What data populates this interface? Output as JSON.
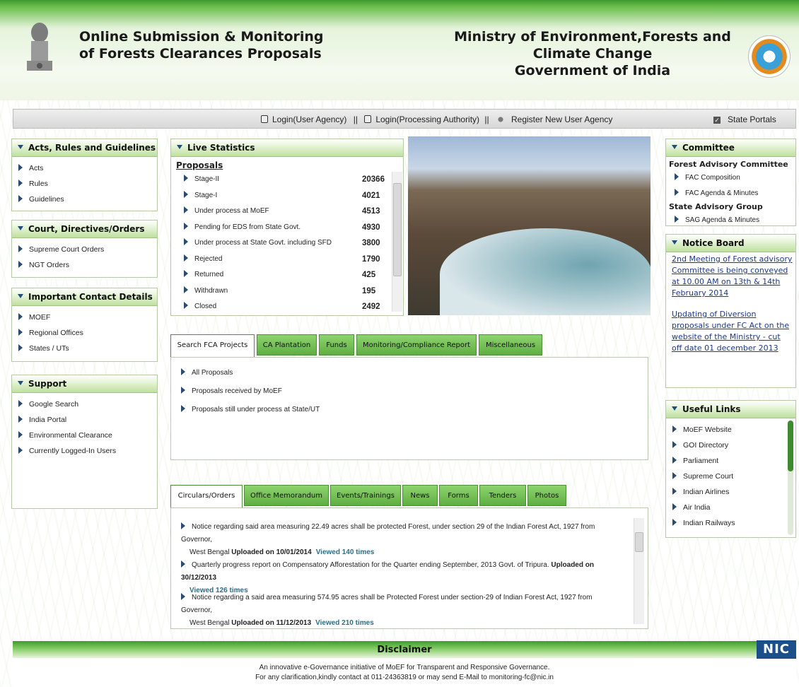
{
  "header": {
    "title_line1": "Online Submission & Monitoring",
    "title_line2": "of Forests Clearances Proposals",
    "ministry_line1": "Ministry of Environment,Forests and Climate Change",
    "ministry_line2": "Government of India"
  },
  "topbar": {
    "login_user": "Login(User Agency)",
    "sep1": "||",
    "login_processing": "Login(Processing Authority)",
    "sep2": "||",
    "register": "Register New User Agency",
    "state_portals": "State Portals"
  },
  "acts": {
    "title": "Acts, Rules and Guidelines",
    "items": [
      "Acts",
      "Rules",
      "Guidelines"
    ]
  },
  "court": {
    "title": "Court, Directives/Orders",
    "items": [
      "Supreme Court Orders",
      "NGT Orders"
    ]
  },
  "contacts": {
    "title": "Important Contact Details",
    "items": [
      "MOEF",
      "Regional Offices",
      "States / UTs"
    ]
  },
  "support": {
    "title": "Support",
    "items": [
      "Google Search",
      "India Portal",
      "Environmental Clearance",
      "Currently Logged-In Users"
    ]
  },
  "stats": {
    "title": "Live Statistics",
    "subtitle": "Proposals",
    "rows": [
      {
        "label": "Stage-II",
        "value": "20366"
      },
      {
        "label": "Stage-I",
        "value": "4021"
      },
      {
        "label": "Under process at MoEF",
        "value": "4513"
      },
      {
        "label": "Pending for EDS from State Govt.",
        "value": "4930"
      },
      {
        "label": "Under process at State Govt. including SFD",
        "value": "3800"
      },
      {
        "label": "Rejected",
        "value": "1790"
      },
      {
        "label": "Returned",
        "value": "425"
      },
      {
        "label": "Withdrawn",
        "value": "195"
      },
      {
        "label": "Closed",
        "value": "2492"
      }
    ]
  },
  "search_tabs": {
    "tabs": [
      "Search FCA Projects",
      "CA Plantation",
      "Funds",
      "Monitoring/Compliance Report",
      "Miscellaneous"
    ],
    "items": [
      "All Proposals",
      "Proposals received by MoEF",
      "Proposals still under process at State/UT"
    ]
  },
  "circular_tabs": {
    "tabs": [
      "Circulars/Orders",
      "Office Memorandum",
      "Events/Trainings",
      "News",
      "Forms",
      "Tenders",
      "Photos"
    ],
    "entries": [
      {
        "text1": "Notice regarding said area measuring 22.49 acres shall be protected Forest, under section 29 of the Indian Forest Act, 1927 from Governor,",
        "text2": "West Bengal",
        "uploaded": "Uploaded on 10/01/2014",
        "views": "Viewed 140 times"
      },
      {
        "text1": "Quarterly progress report on Compensatory Afforestation for the Quarter ending September, 2013 Govt. of Tripura.",
        "uploaded": "Uploaded on 30/12/2013",
        "views": "Viewed 126 times"
      },
      {
        "text1": "Notice regarding a said area measuring 574.95 acres shall be Protected Forest under section-29 of Indian Forest Act, 1927 from Governor,",
        "text2": "West Bengal",
        "uploaded": "Uploaded on 11/12/2013",
        "views": "Viewed 210 times"
      }
    ]
  },
  "committee": {
    "title": "Committee",
    "fac_heading": "Forest Advisory Committee",
    "fac_items": [
      "FAC Composition",
      "FAC Agenda & Minutes"
    ],
    "sag_heading": "State Advisory Group",
    "sag_items": [
      "SAG Agenda & Minutes"
    ]
  },
  "notice": {
    "title": "Notice Board",
    "items": [
      "2nd Meeting of Forest advisory Committee is being conveyed at 10.00 AM on 13th & 14th February 2014",
      "Updating of Diversion proposals under FC Act on the website of the Ministry - cut off date 01 december 2013"
    ]
  },
  "useful": {
    "title": "Useful Links",
    "items": [
      "MoEF Website",
      "GOI Directory",
      "Parliament",
      "Supreme Court",
      "Indian Airlines",
      "Air India",
      "Indian Railways"
    ]
  },
  "footer": {
    "title": "Disclaimer",
    "line1": "An innovative e-Governance initiative of MoEF for Transparent and Responsive Governance.",
    "line2": "For any clarification,kindly contact at 011-24363819 or may send E-Mail to monitoring-fc@nic.in",
    "nic": "NIC"
  },
  "colors": {
    "header_green": "#3e9a2e",
    "tab_green": "#5fae42",
    "link_blue": "#1a3a8a"
  }
}
